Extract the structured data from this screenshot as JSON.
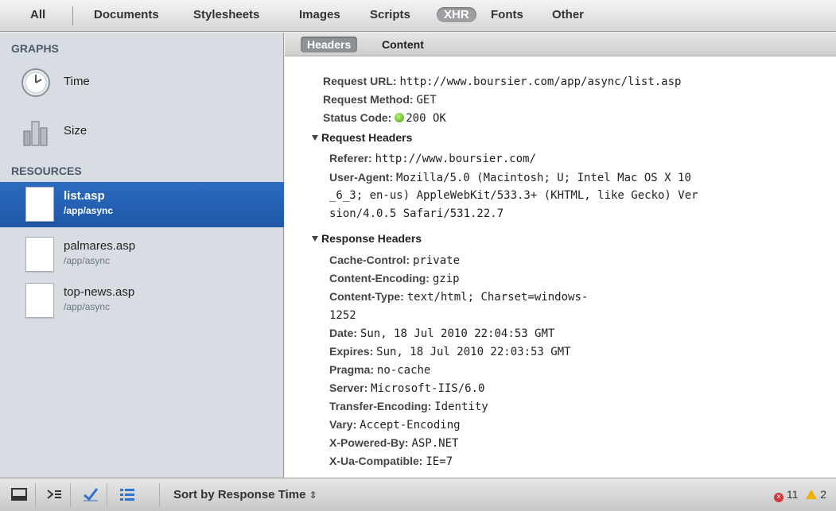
{
  "filters": {
    "all": "All",
    "documents": "Documents",
    "stylesheets": "Stylesheets",
    "images": "Images",
    "scripts": "Scripts",
    "xhr": "XHR",
    "fonts": "Fonts",
    "other": "Other",
    "selected": "XHR"
  },
  "sidebar": {
    "graphs_title": "GRAPHS",
    "graphs": [
      {
        "label": "Time",
        "icon": "clock-icon"
      },
      {
        "label": "Size",
        "icon": "size-bars-icon"
      }
    ],
    "resources_title": "RESOURCES",
    "resources": [
      {
        "name": "list.asp",
        "path": "/app/async",
        "selected": true
      },
      {
        "name": "palmares.asp",
        "path": "/app/async",
        "selected": false
      },
      {
        "name": "top-news.asp",
        "path": "/app/async",
        "selected": false
      }
    ]
  },
  "tabs": {
    "headers": "Headers",
    "content": "Content",
    "active": "Headers"
  },
  "general": {
    "request_url_key": "Request URL:",
    "request_url": "http://www.boursier.com/app/async/list.asp",
    "request_method_key": "Request Method:",
    "request_method": "GET",
    "status_code_key": "Status Code:",
    "status_code": "200 OK",
    "status_color": "#4fa51a"
  },
  "request_headers": {
    "title": "Request Headers",
    "referer_key": "Referer:",
    "referer": "http://www.boursier.com/",
    "user_agent_key": "User-Agent:",
    "user_agent_line1": "Mozilla/5.0 (Macintosh; U; Intel Mac OS X 10",
    "user_agent_line2": "_6_3; en-us) AppleWebKit/533.3+ (KHTML, like Gecko) Ver",
    "user_agent_line3": "sion/4.0.5 Safari/531.22.7"
  },
  "response_headers": {
    "title": "Response Headers",
    "items": [
      {
        "key": "Cache-Control:",
        "value": "private"
      },
      {
        "key": "Content-Encoding:",
        "value": "gzip"
      },
      {
        "key": "Content-Type:",
        "value": "text/html; Charset=windows-"
      },
      {
        "key": "",
        "value": "1252"
      },
      {
        "key": "Date:",
        "value": "Sun, 18 Jul 2010 22:04:53 GMT"
      },
      {
        "key": "Expires:",
        "value": "Sun, 18 Jul 2010 22:03:53 GMT"
      },
      {
        "key": "Pragma:",
        "value": "no-cache"
      },
      {
        "key": "Server:",
        "value": "Microsoft-IIS/6.0"
      },
      {
        "key": "Transfer-Encoding:",
        "value": "Identity"
      },
      {
        "key": "Vary:",
        "value": "Accept-Encoding"
      },
      {
        "key": "X-Powered-By:",
        "value": "ASP.NET"
      },
      {
        "key": "X-Ua-Compatible:",
        "value": "IE=7"
      }
    ]
  },
  "statusbar": {
    "sort_label": "Sort by Response Time",
    "errors": "11",
    "warnings": "2",
    "error_color": "#d23b3b",
    "warning_color": "#f0b000"
  },
  "colors": {
    "selected_row": "#2c6bbf",
    "sidebar_bg": "#d8dde4"
  }
}
